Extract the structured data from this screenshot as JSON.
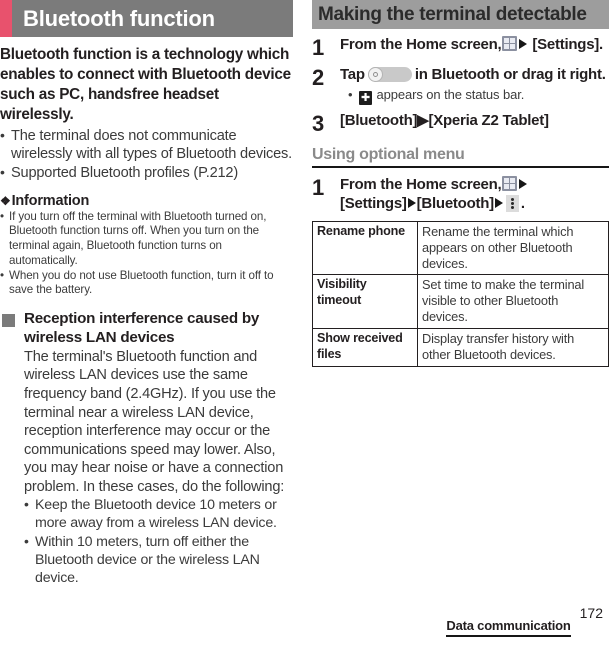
{
  "left": {
    "chapter_title": "Bluetooth function",
    "accent_color": "#e8526d",
    "header_bg": "#7b7b7b",
    "lead": "Bluetooth function is a technology which enables to connect with Bluetooth device such as PC, handsfree headset wirelessly.",
    "bullets": [
      "The terminal does not communicate wirelessly with all types of Bluetooth devices.",
      "Supported Bluetooth profiles (P.212)"
    ],
    "information": {
      "heading": "Information",
      "bullets": [
        "If you turn off the terminal with Bluetooth turned on, Bluetooth function turns off. When you turn on the terminal again, Bluetooth function turns on automatically.",
        "When you do not use Bluetooth function, turn it off to save the battery."
      ]
    },
    "subsection": {
      "heading": "Reception interference caused by wireless LAN devices",
      "body": "The terminal's Bluetooth function and wireless LAN devices use the same frequency band (2.4GHz). If you use the terminal near a wireless LAN device, reception interference may occur or the communications speed may lower. Also, you may hear noise or have a connection problem. In these cases, do the following:",
      "bullets": [
        "Keep the Bluetooth device 10 meters or more away from a wireless LAN device.",
        "Within 10 meters, turn off either the Bluetooth device or the wireless LAN device."
      ]
    }
  },
  "right": {
    "section_title": "Making the terminal detectable",
    "section_header_bg": "#9d9d9d",
    "steps": [
      {
        "num": "1",
        "parts": [
          "From the Home screen, ",
          "[app-drawer-icon]",
          "[arrow]",
          " [Settings]."
        ],
        "text_before_icon": "From the Home screen,",
        "text_after_icon": "[Settings]."
      },
      {
        "num": "2",
        "text_before_icon": "Tap",
        "text_after_icon": "in Bluetooth or drag it right.",
        "sub": "appears on the status bar."
      },
      {
        "num": "3",
        "text": "[Bluetooth]▶[Xperia Z2 Tablet]"
      }
    ],
    "optional": {
      "heading": "Using optional menu",
      "step_num": "1",
      "step_line1": "From the Home screen,",
      "step_line2_a": "[Settings]",
      "step_line2_b": "[Bluetooth]",
      "step_line2_c": "."
    },
    "table": {
      "rows": [
        {
          "key": "Rename phone",
          "value": "Rename the terminal which appears on other Bluetooth devices."
        },
        {
          "key": "Visibility timeout",
          "value": "Set time to make the terminal visible to other Bluetooth devices."
        },
        {
          "key": "Show received files",
          "value": "Display transfer history with other Bluetooth devices."
        }
      ]
    }
  },
  "footer": {
    "chapter": "Data communication",
    "page": "172"
  }
}
